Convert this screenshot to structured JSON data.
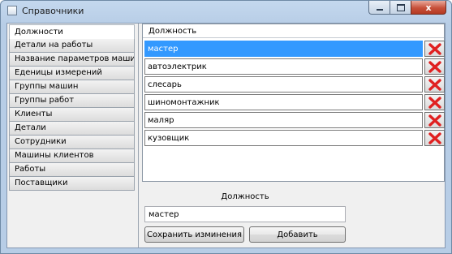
{
  "window": {
    "title": "Справочники",
    "close_glyph": "x"
  },
  "sidebar": {
    "items": [
      {
        "label": "Должности",
        "active": true
      },
      {
        "label": "Детали на работы"
      },
      {
        "label": "Название параметров машин"
      },
      {
        "label": "Еденицы измерений"
      },
      {
        "label": "Группы машин"
      },
      {
        "label": "Группы работ"
      },
      {
        "label": "Клиенты"
      },
      {
        "label": "Детали"
      },
      {
        "label": "Сотрудники"
      },
      {
        "label": "Машины клиентов"
      },
      {
        "label": "Работы"
      },
      {
        "label": "Поставщики"
      }
    ]
  },
  "grid": {
    "column_header": "Должность",
    "rows": [
      "мастер",
      "автоэлектрик",
      "слесарь",
      "шиномонтажник",
      "маляр",
      "кузовщик"
    ],
    "selected_row": "мастер",
    "delete_icon": "red-x-icon"
  },
  "form": {
    "label": "Должность",
    "input_value": "мастер",
    "save_label": "Сохранить изминения",
    "add_label": "Добавить"
  },
  "colors": {
    "selection": "#3399ff",
    "delete_icon": "#e02020",
    "close_button": "#c7503a"
  }
}
